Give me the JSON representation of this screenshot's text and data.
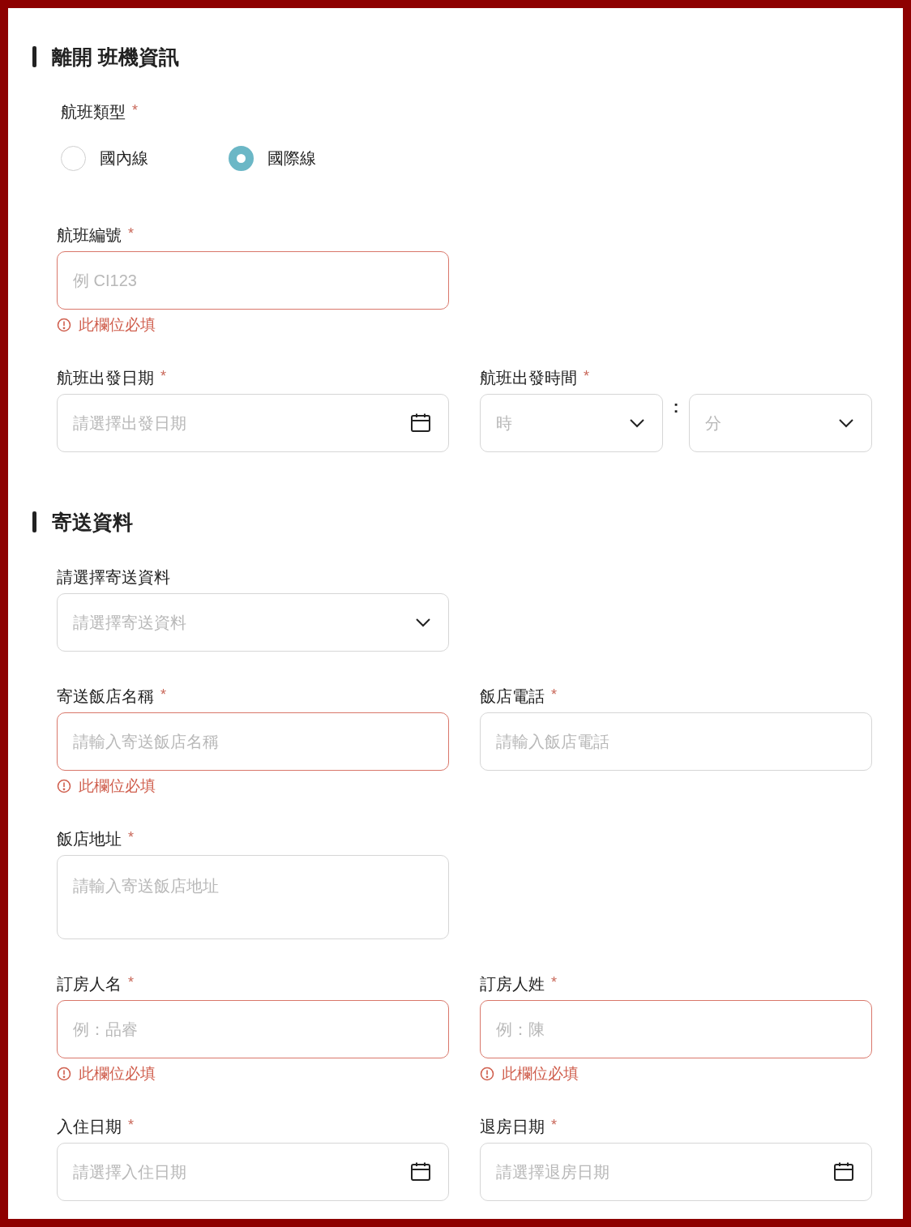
{
  "sections": [
    {
      "title": "離開 班機資訊",
      "rows": [
        {
          "fields": [
            {
              "kind": "radio",
              "label": "航班類型",
              "required_mark": "*",
              "options": [
                {
                  "label": "國內線",
                  "selected": false
                },
                {
                  "label": "國際線",
                  "selected": true
                }
              ]
            }
          ]
        },
        {
          "fields": [
            {
              "kind": "text",
              "label": "航班編號",
              "required_mark": "*",
              "placeholder": "例 CI123",
              "error": "此欄位必填"
            }
          ]
        },
        {
          "fields": [
            {
              "kind": "date",
              "label": "航班出發日期",
              "required_mark": "*",
              "placeholder": "請選擇出發日期"
            },
            {
              "kind": "time",
              "label": "航班出發時間",
              "required_mark": "*",
              "hour_placeholder": "時",
              "separator": ":",
              "minute_placeholder": "分"
            }
          ]
        }
      ]
    },
    {
      "title": "寄送資料",
      "rows": [
        {
          "fields": [
            {
              "kind": "select",
              "label": "請選擇寄送資料",
              "placeholder": "請選擇寄送資料"
            }
          ]
        },
        {
          "fields": [
            {
              "kind": "text",
              "label": "寄送飯店名稱",
              "required_mark": "*",
              "placeholder": "請輸入寄送飯店名稱",
              "error": "此欄位必填"
            },
            {
              "kind": "text",
              "label": "飯店電話",
              "required_mark": "*",
              "placeholder": "請輸入飯店電話"
            }
          ]
        },
        {
          "fields": [
            {
              "kind": "textarea",
              "label": "飯店地址",
              "required_mark": "*",
              "placeholder": "請輸入寄送飯店地址"
            }
          ]
        },
        {
          "fields": [
            {
              "kind": "text",
              "label": "訂房人名",
              "required_mark": "*",
              "placeholder": "例：品睿",
              "error": "此欄位必填"
            },
            {
              "kind": "text",
              "label": "訂房人姓",
              "required_mark": "*",
              "placeholder": "例：陳",
              "error": "此欄位必填"
            }
          ]
        },
        {
          "fields": [
            {
              "kind": "date",
              "label": "入住日期",
              "required_mark": "*",
              "placeholder": "請選擇入住日期"
            },
            {
              "kind": "date",
              "label": "退房日期",
              "required_mark": "*",
              "placeholder": "請選擇退房日期"
            }
          ]
        }
      ]
    }
  ]
}
